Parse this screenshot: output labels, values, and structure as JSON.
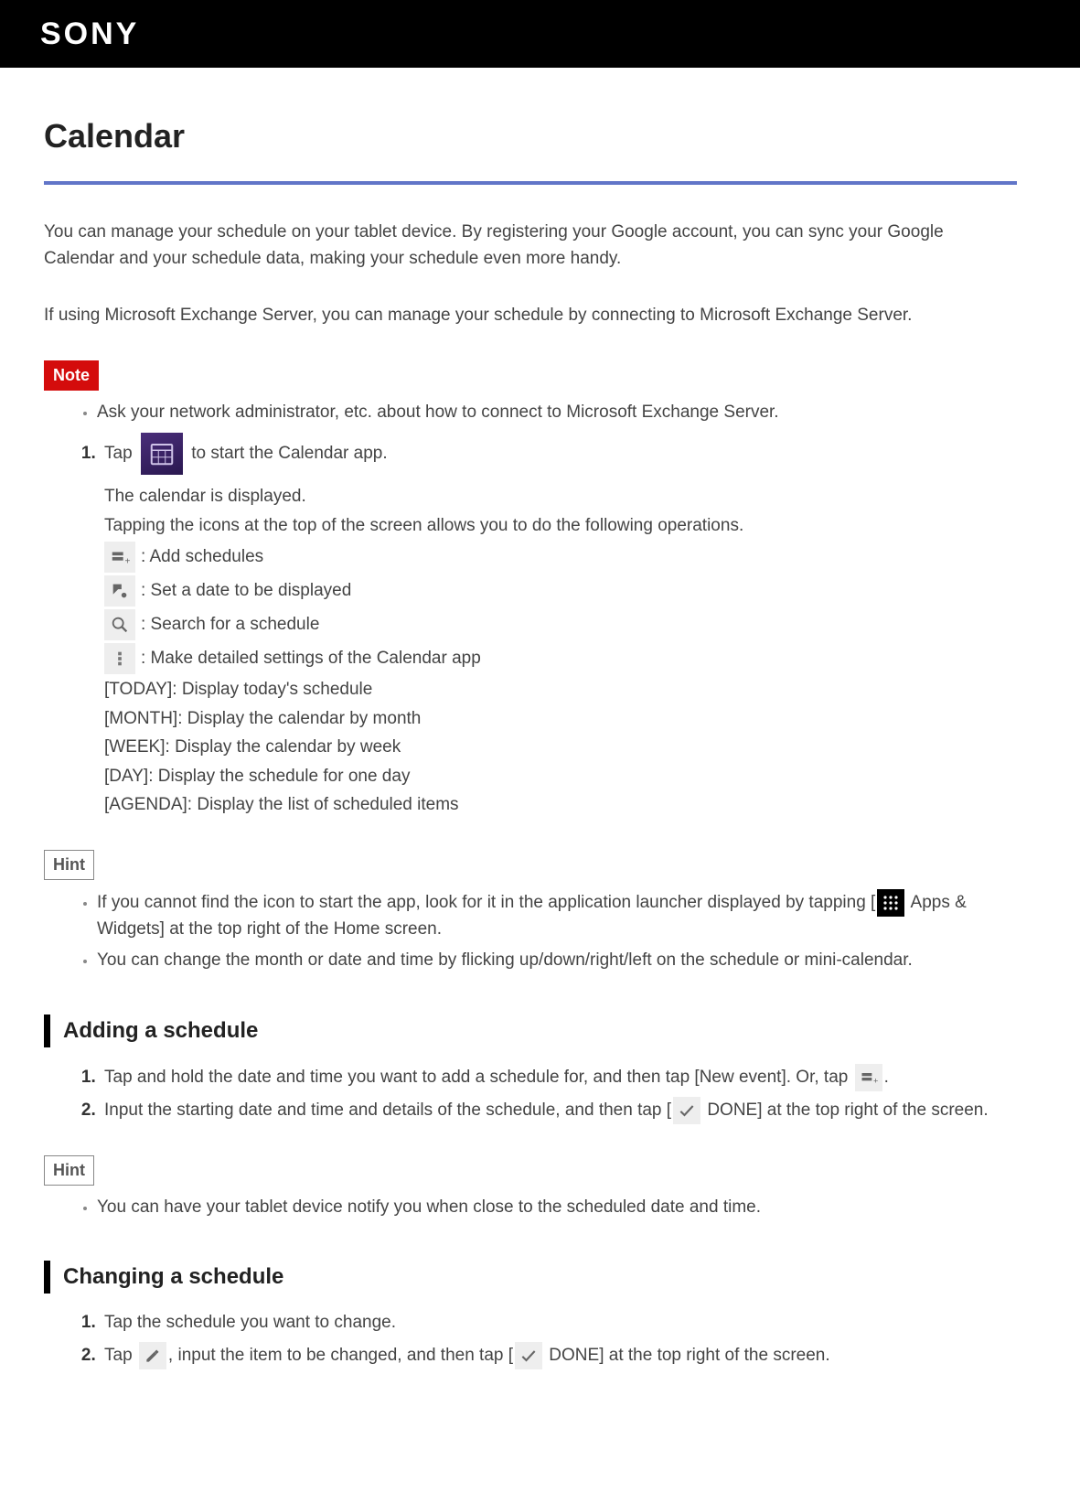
{
  "logo": "SONY",
  "title": "Calendar",
  "intro1": "You can manage your schedule on your tablet device. By registering your Google account, you can sync your Google Calendar and your schedule data, making your schedule even more handy.",
  "intro2": "If using Microsoft Exchange Server, you can manage your schedule by connecting to Microsoft Exchange Server.",
  "note_label": "Note",
  "note_bullet": "Ask your network administrator, etc. about how to connect to Microsoft Exchange Server.",
  "step1_pre": "Tap ",
  "step1_post": " to start the Calendar app.",
  "step1_sub1": "The calendar is displayed.",
  "step1_sub2": "Tapping the icons at the top of the screen allows you to do the following operations.",
  "icon_add": ": Add schedules",
  "icon_date": ": Set a date to be displayed",
  "icon_search": ": Search for a schedule",
  "icon_settings": ": Make detailed settings of the Calendar app",
  "views": {
    "today": "[TODAY]: Display today's schedule",
    "month": "[MONTH]: Display the calendar by month",
    "week": "[WEEK]: Display the calendar by week",
    "day": "[DAY]: Display the schedule for one day",
    "agenda": "[AGENDA]: Display the list of scheduled items"
  },
  "hint_label": "Hint",
  "hint1_a": "If you cannot find the icon to start the app, look for it in the application launcher displayed by tapping [",
  "hint1_b": " Apps & Widgets] at the top right of the Home screen.",
  "hint2": "You can change the month or date and time by flicking up/down/right/left on the schedule or mini-calendar.",
  "section_add": "Adding a schedule",
  "add_step1_pre": "Tap and hold the date and time you want to add a schedule for, and then tap [New event]. Or, tap ",
  "add_step1_post": ".",
  "add_step2_pre": "Input the starting date and time and details of the schedule, and then tap [",
  "add_step2_post": " DONE] at the top right of the screen.",
  "add_hint": "You can have your tablet device notify you when close to the scheduled date and time.",
  "section_change": "Changing a schedule",
  "change_step1": "Tap the schedule you want to change.",
  "change_step2_a": "Tap ",
  "change_step2_b": ", input the item to be changed, and then tap [",
  "change_step2_c": " DONE] at the top right of the screen."
}
